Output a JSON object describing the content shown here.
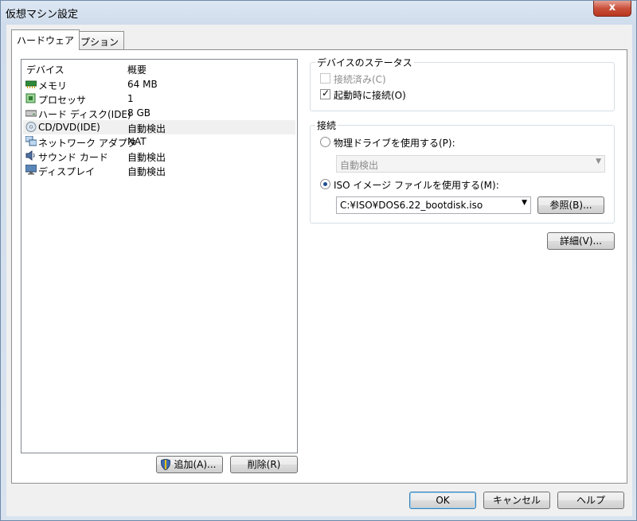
{
  "window": {
    "title": "仮想マシン設定",
    "close_glyph": "x"
  },
  "tabs": [
    {
      "label": "ハードウェア"
    },
    {
      "label": "オプション"
    }
  ],
  "device_list": {
    "headers": {
      "device": "デバイス",
      "summary": "概要"
    },
    "rows": [
      {
        "name": "メモリ",
        "summary": "64 MB",
        "icon": "memory-icon"
      },
      {
        "name": "プロセッサ",
        "summary": "1",
        "icon": "processor-icon"
      },
      {
        "name": "ハード ディスク(IDE)",
        "summary": "8 GB",
        "icon": "hard-disk-icon"
      },
      {
        "name": "CD/DVD(IDE)",
        "summary": "自動検出",
        "icon": "cd-dvd-icon"
      },
      {
        "name": "ネットワーク アダプタ",
        "summary": "NAT",
        "icon": "network-adapter-icon"
      },
      {
        "name": "サウンド カード",
        "summary": "自動検出",
        "icon": "sound-card-icon"
      },
      {
        "name": "ディスプレイ",
        "summary": "自動検出",
        "icon": "display-icon"
      }
    ]
  },
  "buttons": {
    "add": "追加(A)...",
    "remove": "削除(R)",
    "browse": "参照(B)...",
    "advanced": "詳細(V)...",
    "ok": "OK",
    "cancel": "キャンセル",
    "help": "ヘルプ"
  },
  "device_status": {
    "title": "デバイスのステータス",
    "connected": {
      "label": "接続済み(C)",
      "checked": false,
      "enabled": false
    },
    "connect_at_power_on": {
      "label": "起動時に接続(O)",
      "checked": true,
      "enabled": true
    }
  },
  "connection": {
    "title": "接続",
    "physical_drive": {
      "label": "物理ドライブを使用する(P):",
      "selected": false,
      "value": "自動検出"
    },
    "iso_image": {
      "label": "ISO イメージ ファイルを使用する(M):",
      "selected": true,
      "value": "C:¥ISO¥DOS6.22_bootdisk.iso"
    }
  }
}
